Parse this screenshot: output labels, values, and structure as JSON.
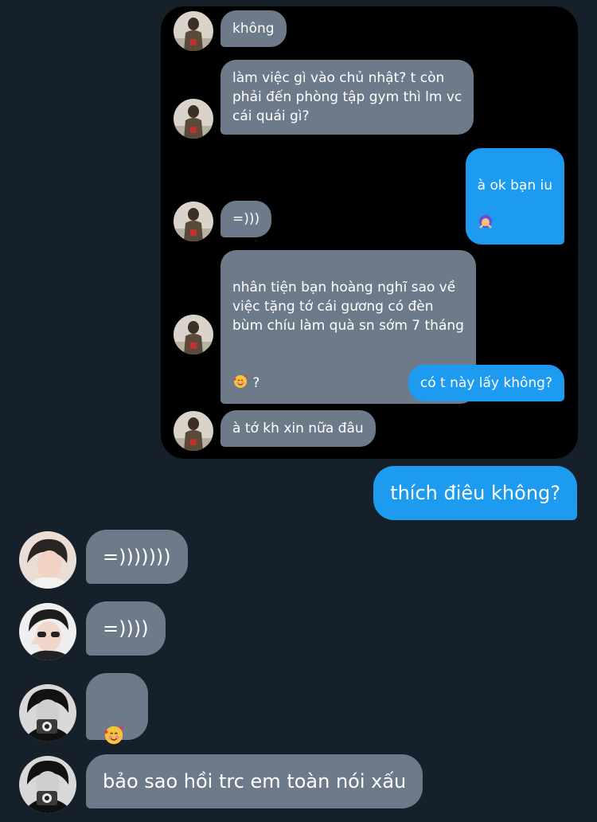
{
  "inner_thread": {
    "messages": [
      {
        "sender": "them",
        "text": "không"
      },
      {
        "sender": "them",
        "text": "làm việc gì vào chủ nhật? t còn\nphải đến phòng tập gym thì lm vc\ncái quái gì?"
      },
      {
        "sender": "me",
        "text": "à ok bạn iu",
        "emoji": "person-gesturing-no-emoji"
      },
      {
        "sender": "them",
        "text": "=)))"
      },
      {
        "sender": "them",
        "text": "nhân tiện bạn hoàng nghĩ sao về\nviệc tặng tớ cái gương có đèn\nbùm chíu làm quà sn sớm 7 tháng",
        "emoji": "smiling-face-with-hearts-emoji",
        "after_emoji": " ?"
      },
      {
        "sender": "me",
        "text": "có t này lấy không?"
      },
      {
        "sender": "them",
        "text": "à tớ kh xin nữa đâu"
      }
    ]
  },
  "main_thread": {
    "messages": [
      {
        "sender": "me",
        "text": "thích điêu không?"
      },
      {
        "sender": "them",
        "text": "=)))))))"
      },
      {
        "sender": "them",
        "text": "=))))"
      },
      {
        "sender": "them",
        "text": "",
        "emoji": "smiling-face-with-hearts-emoji"
      },
      {
        "sender": "them",
        "text": "bảo sao hồi trc em toàn nói xấu"
      }
    ]
  },
  "colors": {
    "background": "#15202b",
    "card": "#000000",
    "incoming_bubble": "#6c7a89",
    "outgoing_bubble": "#1d9bf0",
    "text": "#ffffff"
  }
}
